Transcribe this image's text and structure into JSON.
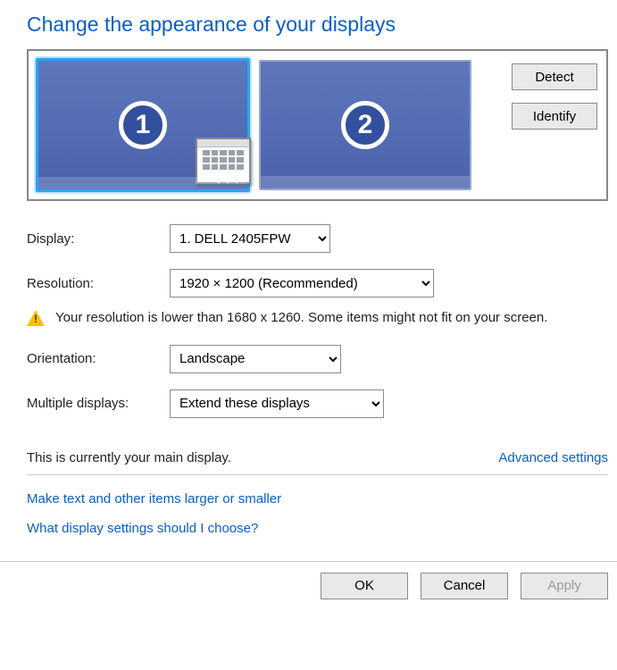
{
  "title": "Change the appearance of your displays",
  "monitors": {
    "primary_num": "1",
    "secondary_num": "2"
  },
  "buttons": {
    "detect": "Detect",
    "identify": "Identify",
    "ok": "OK",
    "cancel": "Cancel",
    "apply": "Apply"
  },
  "labels": {
    "display": "Display:",
    "resolution": "Resolution:",
    "orientation": "Orientation:",
    "multiple": "Multiple displays:",
    "main_display": "This is currently your main display.",
    "advanced": "Advanced settings"
  },
  "selects": {
    "display_value": "1. DELL 2405FPW",
    "resolution_value": "1920 × 1200 (Recommended)",
    "orientation_value": "Landscape",
    "multiple_value": "Extend these displays"
  },
  "warning_text": "Your resolution is lower than 1680 x 1260. Some items might not fit on your screen.",
  "links": {
    "text_size": "Make text and other items larger or smaller",
    "help": "What display settings should I choose?"
  }
}
